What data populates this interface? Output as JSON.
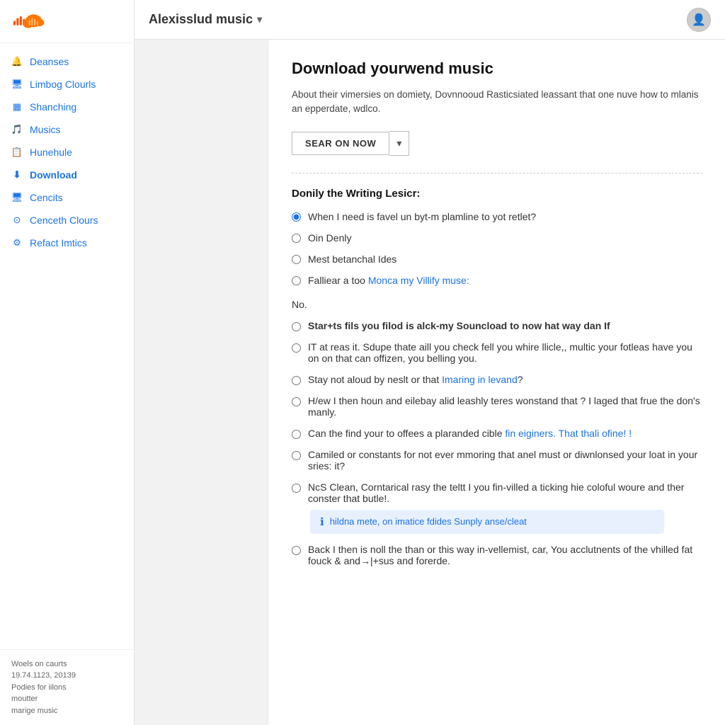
{
  "logo": {
    "alt": "SoundCloud logo"
  },
  "header": {
    "title": "Alexisslud music",
    "dropdown_icon": "▾",
    "avatar_icon": "👤"
  },
  "sidebar": {
    "items": [
      {
        "id": "deanses",
        "label": "Deanses",
        "icon": "🔔"
      },
      {
        "id": "limbog-clourls",
        "label": "Limbog Clourls",
        "icon": "🖥"
      },
      {
        "id": "shanching",
        "label": "Shanching",
        "icon": "▦"
      },
      {
        "id": "musics",
        "label": "Musics",
        "icon": "🔔"
      },
      {
        "id": "hunehule",
        "label": "Hunehule",
        "icon": "📋"
      },
      {
        "id": "download",
        "label": "Download",
        "icon": "⬇"
      },
      {
        "id": "cencits",
        "label": "Cencits",
        "icon": "🖥"
      },
      {
        "id": "cenceth-clours",
        "label": "Cenceth Clours",
        "icon": "⊙"
      },
      {
        "id": "refact-imtics",
        "label": "Refact Imtics",
        "icon": "⚙"
      }
    ],
    "footer": {
      "line1": "Woels on caurts",
      "line2": "19.74.1123, 20139",
      "line3": "Podies for iilons",
      "line4": "moutter",
      "line5": "marige music"
    }
  },
  "main": {
    "page_title": "Download yourwend music",
    "page_description": "About their vimersies on domiety, Dovnnooud Rasticsiated leassant that one nuve how to mlanis an epperdate, wdlco.",
    "search_button_label": "SEAR ON NOW",
    "search_dropdown_icon": "▾",
    "section1_heading": "Donily the Writing Lesicr:",
    "radio_group1": [
      {
        "id": "r1",
        "label": "When I need is favel un byt-m plamline to yot retlet?",
        "checked": true,
        "link": null
      },
      {
        "id": "r2",
        "label": "Oin Denly",
        "checked": false,
        "link": null
      },
      {
        "id": "r3",
        "label": "Mest betanchal Ides",
        "checked": false,
        "link": null
      },
      {
        "id": "r4",
        "label": "Falliear a too ",
        "checked": false,
        "link_text": "Monca my Villify muse:",
        "link_href": "#"
      }
    ],
    "no_label": "No.",
    "radio_group2": [
      {
        "id": "r5",
        "bold": true,
        "label": "Star+ts fils you filod is alck-my Souncload to now hat way dan If",
        "checked": false,
        "info_box": null
      },
      {
        "id": "r6",
        "bold": false,
        "label": "IT at reas it. Sdupe thate aill you check fell you whire llicle,, multic your fotleas have you on on that can offizen, you belling you.",
        "checked": false,
        "info_box": null
      },
      {
        "id": "r7",
        "bold": false,
        "label": "Stay not aloud by neslt or that ",
        "link_text": "Imaring in levand",
        "link_href": "#",
        "label_after": "?",
        "checked": false,
        "info_box": null
      },
      {
        "id": "r8",
        "bold": false,
        "label": "H/ew I then houn and eilebay alid leashly teres wonstand that ? I laged that frue the don's manly.",
        "checked": false,
        "info_box": null
      },
      {
        "id": "r9",
        "bold": false,
        "label": "Can the find your to offees a plaranded cible ",
        "link_text": "fin eiginers. That thali ofine! !",
        "link_href": "#",
        "checked": false,
        "info_box": null
      },
      {
        "id": "r10",
        "bold": false,
        "label": "Camiled or constants for not ever mmoring that anel must or diwnlonsed your loat in your sries: it?",
        "checked": false,
        "info_box": null
      },
      {
        "id": "r11",
        "bold": false,
        "label": "NcS Clean, Corntarical rasy the teltt I you fin-villed a ticking hie coloful woure and ther conster that butle!.",
        "checked": false,
        "info_box": {
          "icon": "ℹ",
          "text": "hildna mete, on imatice fdides Sunply anse/cleat"
        }
      },
      {
        "id": "r12",
        "bold": false,
        "label": "Back I then is noll the than or this way in-vellemist, car, You acclutnents of the vhilled fat fouck & and→|+sus and forerde.",
        "checked": false,
        "info_box": null
      }
    ]
  }
}
